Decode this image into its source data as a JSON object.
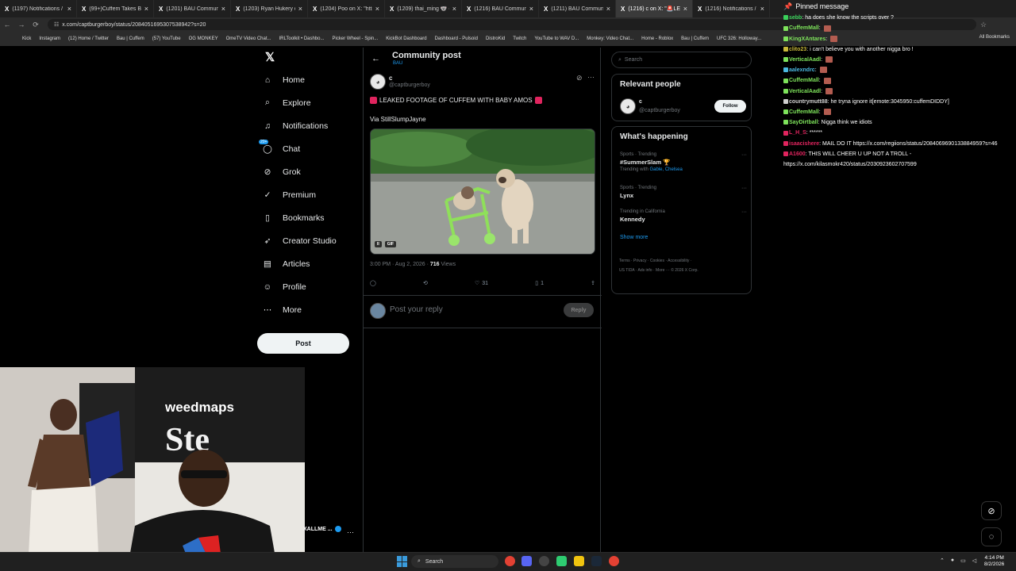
{
  "browser": {
    "tabs": [
      {
        "label": "(1197) Notifications / X",
        "active": false
      },
      {
        "label": "(99+)Cuffem Takes Brea",
        "active": false
      },
      {
        "label": "(1201) BAU Community",
        "active": false
      },
      {
        "label": "(1203) Ryan Hukery on",
        "active": false
      },
      {
        "label": "(1204) Poo on X: \"http",
        "active": false
      },
      {
        "label": "(1209) thai_ming 🐨 on",
        "active": false
      },
      {
        "label": "(1216) BAU Community",
        "active": false
      },
      {
        "label": "(1211) BAU Community",
        "active": false
      },
      {
        "label": "(1216) c on X: \"🚨LEA",
        "active": true
      },
      {
        "label": "(1216) Notifications / X",
        "active": false
      }
    ],
    "url": "x.com/captburgerboy/status/2084051695307538942?s=20",
    "bookmarks": [
      "Kick",
      "Instagram",
      "(12) Home / Twitter",
      "Bau | Cuffem",
      "(57) YouTube",
      "OG MONKEY",
      "OmeTV Video Chat...",
      "IRLToolkit • Dashbo...",
      "Picker Wheel - Spin...",
      "KickBot Dashboard",
      "Dashboard - Pulsoid",
      "DistroKid",
      "Twitch",
      "YouTube to WAV D...",
      "Monkey: Video Chat...",
      "Home - Roblox",
      "Bau | Cuffem",
      "UFC 326: Holloway..."
    ],
    "all_bookmarks": "All Bookmarks"
  },
  "nav": {
    "items": [
      {
        "label": "Home",
        "icon": "home-icon"
      },
      {
        "label": "Explore",
        "icon": "search-icon"
      },
      {
        "label": "Notifications",
        "icon": "bell-icon"
      },
      {
        "label": "Chat",
        "icon": "chat-icon",
        "badge": "20+"
      },
      {
        "label": "Grok",
        "icon": "grok-icon"
      },
      {
        "label": "Premium",
        "icon": "premium-icon"
      },
      {
        "label": "Bookmarks",
        "icon": "bookmark-icon"
      },
      {
        "label": "Creator Studio",
        "icon": "rocket-icon"
      },
      {
        "label": "Articles",
        "icon": "article-icon"
      },
      {
        "label": "Profile",
        "icon": "profile-icon"
      },
      {
        "label": "More",
        "icon": "more-icon"
      }
    ],
    "post_label": "Post"
  },
  "post": {
    "header_title": "Community post",
    "header_sub": "BAU",
    "author_name": "c",
    "author_handle": "@captburgerboy",
    "text_line1": "LEAKED FOOTAGE OF CUFFEM WITH BABY AMOS",
    "text_line2": "Via StillSlumpJayne",
    "gif_label": "GIF",
    "time": "3:00 PM · Aug 2, 2026 · ",
    "views_count": "716",
    "views_label": " Views",
    "likes": "31",
    "bookmarks": "1",
    "reply_placeholder": "Post your reply",
    "reply_button": "Reply"
  },
  "sidebar": {
    "search_placeholder": "Search",
    "relevant_title": "Relevant people",
    "relevant_name": "c",
    "relevant_handle": "@captburgerboy",
    "follow_label": "Follow",
    "happening_title": "What's happening",
    "trends": [
      {
        "context": "Sports · Trending",
        "name": "#SummerSlam 🏆",
        "with_prefix": "Trending with ",
        "with": "Gable, Chelsea"
      },
      {
        "context": "Sports · Trending",
        "name": "Lynx",
        "with_prefix": "",
        "with": ""
      },
      {
        "context": "Trending in California",
        "name": "Kennedy",
        "with_prefix": "",
        "with": ""
      }
    ],
    "show_more": "Show more",
    "footer_line1": "Terms · Privacy · Cookies · Accessibility ·",
    "footer_line2": "US TIDA · Ads info · More ··· © 2026 X Corp."
  },
  "chat": {
    "pinned": "Pinned message",
    "messages": [
      {
        "user": "sebb",
        "text": "ha does she know the scripts over ?",
        "color": "#3ad15a"
      },
      {
        "user": "CuffemMall",
        "text": "",
        "color": "#7ee35b"
      },
      {
        "user": "KingXAntares",
        "text": "",
        "color": "#7ee35b"
      },
      {
        "user": "clito23",
        "text": "i can't believe you with another nigga bro !",
        "color": "#c8b93a"
      },
      {
        "user": "VerticalAadl",
        "text": "",
        "color": "#7ee35b"
      },
      {
        "user": "aalexndrc",
        "text": "",
        "color": "#4bb9e0"
      },
      {
        "user": "CuffemMall",
        "text": "",
        "color": "#7ee35b"
      },
      {
        "user": "VerticalAadl",
        "text": "",
        "color": "#7ee35b"
      },
      {
        "user": "countrymutt88",
        "text": "he tryna ignore it[emote:3045950:cuffemDIDDY]",
        "color": "#cfcfcf"
      },
      {
        "user": "CuffemMall",
        "text": "",
        "color": "#7ee35b"
      },
      {
        "user": "SayDirtball",
        "text": "Nigga think we idiots",
        "color": "#7ee35b"
      },
      {
        "user": "L_H_S",
        "text": "******",
        "color": "#e0245e"
      },
      {
        "user": "isaacishere",
        "text": "MAIL DO IT https://x.com/regiions/status/2084069690133884959?s=46",
        "color": "#e0245e"
      },
      {
        "user": "A1600",
        "text": "THIS WILL CHEER U UP NOT A TROLL - https://x.com/kilasmokr420/status/2030923602707599",
        "color": "#e0245e"
      }
    ]
  },
  "cam": {
    "banner": "weedmaps",
    "overlay_name": "XALLME ..."
  },
  "taskbar": {
    "search": "Search",
    "time": "4:14 PM",
    "date": "8/2/2026"
  }
}
